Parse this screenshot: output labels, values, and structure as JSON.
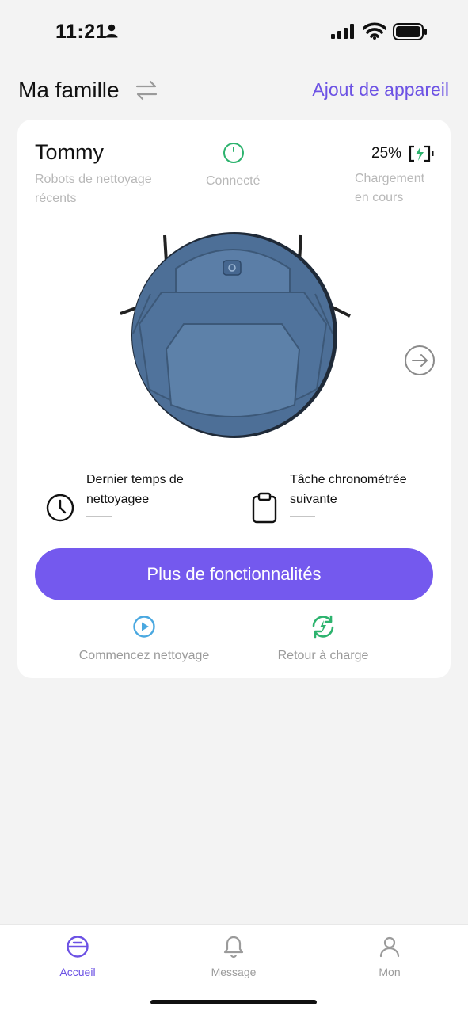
{
  "status_bar": {
    "time": "11:21",
    "icons": [
      "person-icon",
      "signal-icon",
      "wifi-icon",
      "battery-icon"
    ]
  },
  "header": {
    "title": "Ma famille",
    "add_device": "Ajout de appareil",
    "swap_icon": "swap-arrows-icon"
  },
  "device": {
    "name": "Tommy",
    "subtitle": "Robots de nettoyage récents",
    "connection": "Connecté",
    "battery_percent": "25%",
    "charging_status": "Chargement en cours",
    "last_clean_label": "Dernier temps de nettoyagee",
    "last_clean_value": "——",
    "next_task_label": "Tâche chronométrée suivante",
    "next_task_value": "——",
    "more_features": "Plus de fonctionnalités",
    "actions": {
      "start_clean": "Commencez nettoyage",
      "return_charge": "Retour à charge"
    }
  },
  "bottom_nav": {
    "items": [
      {
        "label": "Accueil",
        "icon": "robot-vacuum-icon",
        "active": true
      },
      {
        "label": "Message",
        "icon": "bell-icon",
        "active": false
      },
      {
        "label": "Mon",
        "icon": "user-icon",
        "active": false
      }
    ]
  },
  "colors": {
    "accent": "#7459ee",
    "link": "#6c52e4",
    "connected_green": "#2db36e",
    "play_blue": "#4aa8e0",
    "robot_blue": "#4d6f97",
    "background": "#f3f3f3",
    "card": "#ffffff"
  }
}
